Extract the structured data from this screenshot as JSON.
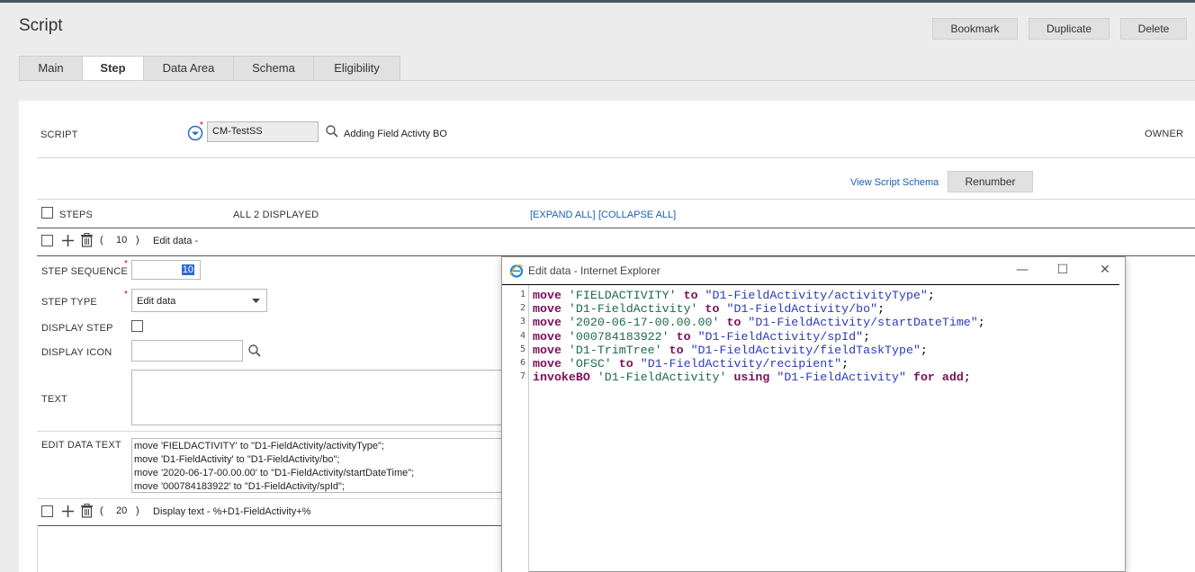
{
  "header": {
    "title": "Script",
    "buttons": {
      "bookmark": "Bookmark",
      "duplicate": "Duplicate",
      "delete": "Delete"
    }
  },
  "tabs": [
    "Main",
    "Step",
    "Data Area",
    "Schema",
    "Eligibility"
  ],
  "active_tab": "Step",
  "script": {
    "label": "SCRIPT",
    "value": "CM-TestSS",
    "description": "Adding Field Activty BO",
    "owner_label": "OWNER"
  },
  "actions": {
    "view_schema": "View Script Schema",
    "renumber": "Renumber"
  },
  "steps_header": {
    "label": "STEPS",
    "count": "ALL 2 DISPLAYED",
    "expand_all": "[EXPAND ALL]",
    "collapse_all": "[COLLAPSE ALL]"
  },
  "step1": {
    "paren_open": "(",
    "seq": "10",
    "paren_close": ")",
    "summary": "Edit data -"
  },
  "step_form": {
    "seq_label": "STEP SEQUENCE",
    "seq_value": "10",
    "type_label": "STEP TYPE",
    "type_value": "Edit data",
    "display_step_label": "DISPLAY STEP",
    "display_icon_label": "DISPLAY ICON",
    "text_label": "TEXT",
    "edit_data_label": "EDIT DATA TEXT",
    "edit_data_lines": [
      "move 'FIELDACTIVITY' to \"D1-FieldActivity/activityType\";",
      "move 'D1-FieldActivity' to \"D1-FieldActivity/bo\";",
      "move '2020-06-17-00.00.00' to \"D1-FieldActivity/startDateTime\";",
      "move '000784183922' to \"D1-FieldActivity/spId\";"
    ]
  },
  "step2": {
    "paren_open": "(",
    "seq": "20",
    "paren_close": ")",
    "summary": "Display text - %+D1-FieldActivity+%"
  },
  "popup": {
    "title": "Edit data - Internet Explorer",
    "controls": {
      "minimize": "—",
      "maximize": "☐",
      "close": "✕"
    },
    "line_numbers": [
      "1",
      "2",
      "3",
      "4",
      "5",
      "6",
      "7"
    ],
    "lines": [
      [
        [
          "kw",
          "move"
        ],
        [
          "pl",
          " "
        ],
        [
          "str1",
          "'FIELDACTIVITY'"
        ],
        [
          "pl",
          " "
        ],
        [
          "kw",
          "to"
        ],
        [
          "pl",
          " "
        ],
        [
          "str2",
          "\"D1-FieldActivity/activityType\""
        ],
        [
          "pl",
          ";"
        ]
      ],
      [
        [
          "kw",
          "move"
        ],
        [
          "pl",
          " "
        ],
        [
          "str1",
          "'D1-FieldActivity'"
        ],
        [
          "pl",
          " "
        ],
        [
          "kw",
          "to"
        ],
        [
          "pl",
          " "
        ],
        [
          "str2",
          "\"D1-FieldActivity/bo\""
        ],
        [
          "pl",
          ";"
        ]
      ],
      [
        [
          "kw",
          "move"
        ],
        [
          "pl",
          " "
        ],
        [
          "str1",
          "'2020-06-17-00.00.00'"
        ],
        [
          "pl",
          " "
        ],
        [
          "kw",
          "to"
        ],
        [
          "pl",
          " "
        ],
        [
          "str2",
          "\"D1-FieldActivity/startDateTime\""
        ],
        [
          "pl",
          ";"
        ]
      ],
      [
        [
          "kw",
          "move"
        ],
        [
          "pl",
          " "
        ],
        [
          "str1",
          "'000784183922'"
        ],
        [
          "pl",
          " "
        ],
        [
          "kw",
          "to"
        ],
        [
          "pl",
          " "
        ],
        [
          "str2",
          "\"D1-FieldActivity/spId\""
        ],
        [
          "pl",
          ";"
        ]
      ],
      [
        [
          "kw",
          "move"
        ],
        [
          "pl",
          " "
        ],
        [
          "str1",
          "'D1-TrimTree'"
        ],
        [
          "pl",
          " "
        ],
        [
          "kw",
          "to"
        ],
        [
          "pl",
          " "
        ],
        [
          "str2",
          "\"D1-FieldActivity/fieldTaskType\""
        ],
        [
          "pl",
          ";"
        ]
      ],
      [
        [
          "kw",
          "move"
        ],
        [
          "pl",
          " "
        ],
        [
          "str1",
          "'OFSC'"
        ],
        [
          "pl",
          " "
        ],
        [
          "kw",
          "to"
        ],
        [
          "pl",
          " "
        ],
        [
          "str2",
          "\"D1-FieldActivity/recipient\""
        ],
        [
          "pl",
          ";"
        ]
      ],
      [
        [
          "kw",
          "invokeBO"
        ],
        [
          "pl",
          " "
        ],
        [
          "str1",
          "'D1-FieldActivity'"
        ],
        [
          "pl",
          " "
        ],
        [
          "kw",
          "using"
        ],
        [
          "pl",
          " "
        ],
        [
          "str2",
          "\"D1-FieldActivity\""
        ],
        [
          "pl",
          " "
        ],
        [
          "kw",
          "for add"
        ],
        [
          "pl",
          ";"
        ]
      ]
    ]
  },
  "colors": {
    "link": "#1f5fb0",
    "keyword": "#7a0f5a",
    "string_single": "#1d6a4a",
    "string_double": "#2b3bb8"
  }
}
